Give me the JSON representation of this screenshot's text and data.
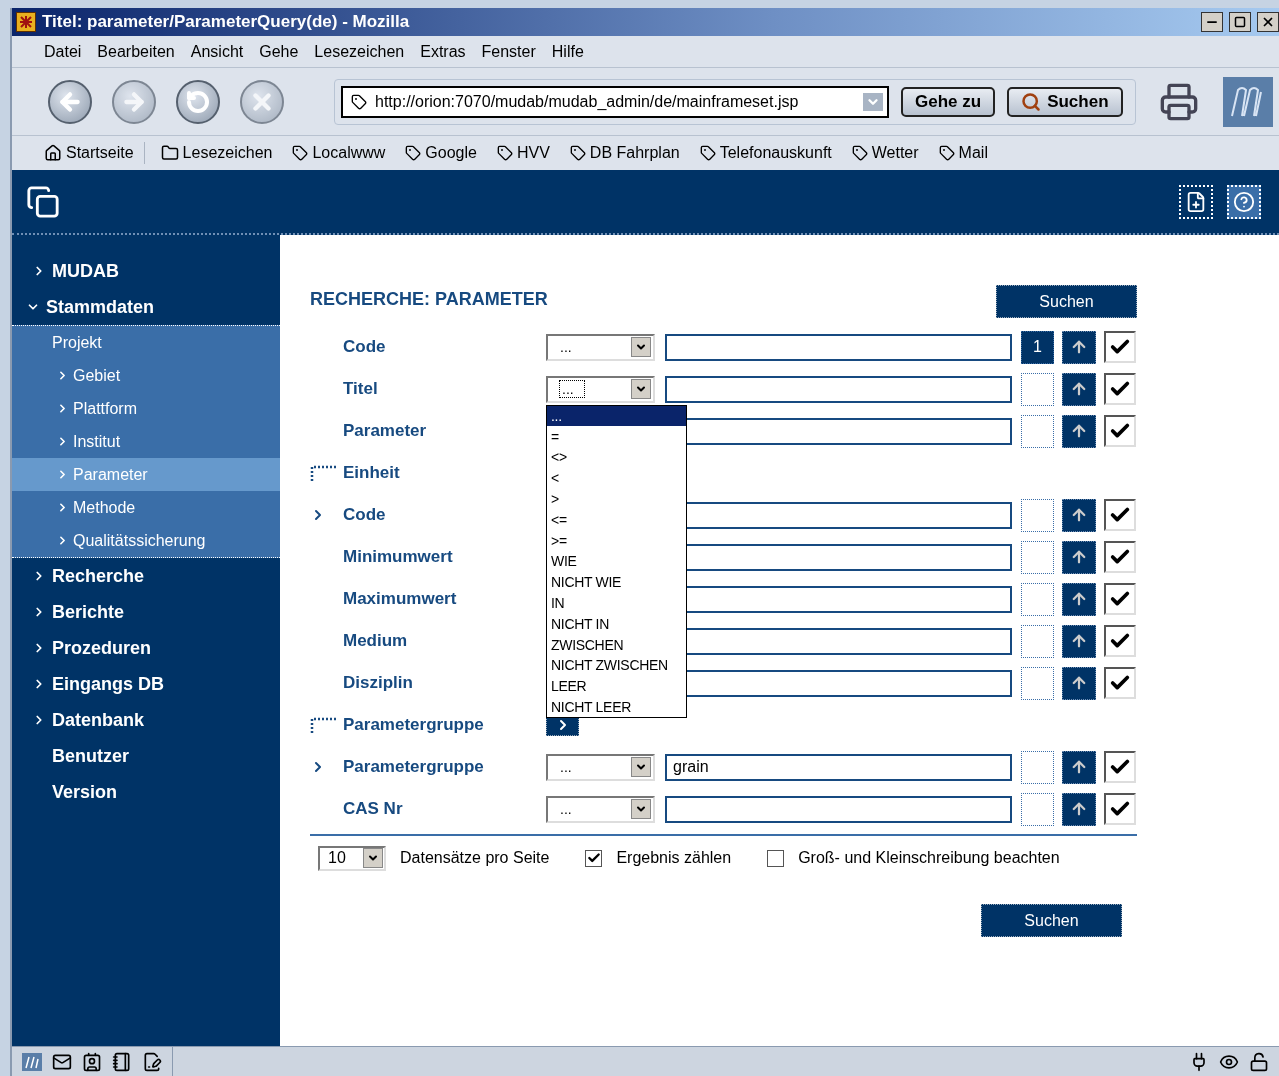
{
  "window": {
    "title": "Titel: parameter/ParameterQuery(de) - Mozilla"
  },
  "menu": [
    "Datei",
    "Bearbeiten",
    "Ansicht",
    "Gehe",
    "Lesezeichen",
    "Extras",
    "Fenster",
    "Hilfe"
  ],
  "toolbar": {
    "url": "http://orion:7070/mudab/mudab_admin/de/mainframeset.jsp",
    "go_button": "Gehe zu",
    "search_button": "Suchen"
  },
  "bookmarks": [
    {
      "label": "Startseite",
      "kind": "home"
    },
    {
      "label": "Lesezeichen",
      "kind": "folder"
    },
    {
      "label": "Localwww",
      "kind": "link"
    },
    {
      "label": "Google",
      "kind": "link"
    },
    {
      "label": "HVV",
      "kind": "link"
    },
    {
      "label": "DB Fahrplan",
      "kind": "link"
    },
    {
      "label": "Telefonauskunft",
      "kind": "link"
    },
    {
      "label": "Wetter",
      "kind": "link"
    },
    {
      "label": "Mail",
      "kind": "link"
    }
  ],
  "sidebar": {
    "items": [
      {
        "label": "MUDAB",
        "kind": "branch",
        "expanded": false,
        "selected": false
      },
      {
        "label": "Stammdaten",
        "kind": "branch",
        "expanded": true,
        "selected": false,
        "children": [
          {
            "label": "Projekt",
            "kind": "plain",
            "selected": false
          },
          {
            "label": "Gebiet",
            "kind": "branch",
            "selected": false
          },
          {
            "label": "Plattform",
            "kind": "branch",
            "selected": false
          },
          {
            "label": "Institut",
            "kind": "branch",
            "selected": false
          },
          {
            "label": "Parameter",
            "kind": "branch",
            "selected": true
          },
          {
            "label": "Methode",
            "kind": "branch",
            "selected": false
          },
          {
            "label": "Qualitätssicherung",
            "kind": "branch",
            "selected": false
          }
        ]
      },
      {
        "label": "Recherche",
        "kind": "branch",
        "expanded": false,
        "selected": false
      },
      {
        "label": "Berichte",
        "kind": "branch",
        "expanded": false,
        "selected": false
      },
      {
        "label": "Prozeduren",
        "kind": "branch",
        "expanded": false,
        "selected": false
      },
      {
        "label": "Eingangs DB",
        "kind": "branch",
        "expanded": false,
        "selected": false
      },
      {
        "label": "Datenbank",
        "kind": "branch",
        "expanded": false,
        "selected": false
      },
      {
        "label": "Benutzer",
        "kind": "plain",
        "selected": false
      },
      {
        "label": "Version",
        "kind": "plain",
        "selected": false
      }
    ]
  },
  "form": {
    "title": "RECHERCHE: PARAMETER",
    "search_button": "Suchen",
    "rows": [
      {
        "kind": "field",
        "label": "Code",
        "operator": "...",
        "order": "1",
        "shown": true
      },
      {
        "kind": "field",
        "label": "Titel",
        "operator": "...",
        "shown": true,
        "dropdown": [
          {
            "label": "...",
            "selected": true
          },
          {
            "label": "=",
            "selected": false
          },
          {
            "label": "<>",
            "selected": false
          },
          {
            "label": "<",
            "selected": false
          },
          {
            "label": ">",
            "selected": false
          },
          {
            "label": "<=",
            "selected": false
          },
          {
            "label": ">=",
            "selected": false
          },
          {
            "label": "WIE",
            "selected": false
          },
          {
            "label": "NICHT WIE",
            "selected": false
          },
          {
            "label": "IN",
            "selected": false
          },
          {
            "label": "NICHT IN",
            "selected": false
          },
          {
            "label": "ZWISCHEN",
            "selected": false
          },
          {
            "label": "NICHT ZWISCHEN",
            "selected": false
          },
          {
            "label": "LEER",
            "selected": false
          },
          {
            "label": "NICHT LEER",
            "selected": false
          }
        ]
      },
      {
        "kind": "field",
        "label": "Parameter",
        "shown": true
      },
      {
        "kind": "group",
        "label": "Einheit"
      },
      {
        "kind": "subfield",
        "label": "Code",
        "shown": true
      },
      {
        "kind": "field",
        "label": "Minimumwert",
        "shown": true
      },
      {
        "kind": "field",
        "label": "Maximumwert",
        "shown": true
      },
      {
        "kind": "field",
        "label": "Medium",
        "shown": true
      },
      {
        "kind": "field",
        "label": "Disziplin",
        "shown": true
      },
      {
        "kind": "group",
        "label": "Parametergruppe",
        "toggle": true
      },
      {
        "kind": "subfield",
        "label": "Parametergruppe",
        "operator": "...",
        "value": "grain",
        "shown": true
      },
      {
        "kind": "field",
        "label": "CAS Nr",
        "operator": "...",
        "shown": true
      }
    ],
    "page_size": "10",
    "page_size_label": "Datensätze pro Seite",
    "options": [
      {
        "label": "Ergebnis zählen",
        "checked": true
      },
      {
        "label": "Groß- und Kleinschreibung beachten",
        "checked": false
      }
    ],
    "bottom_button": "Suchen"
  }
}
